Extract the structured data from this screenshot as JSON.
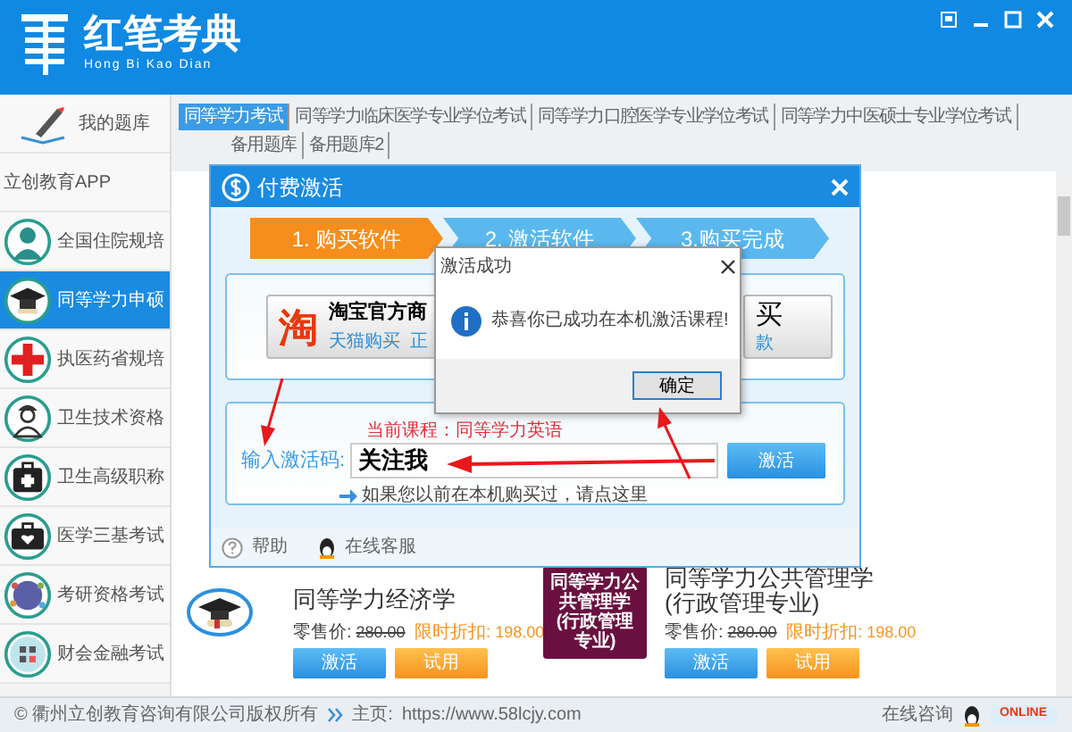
{
  "app": {
    "title": "红笔考典",
    "subtitle": "Hong Bi Kao Dian"
  },
  "sidebar": {
    "library": "我的题库",
    "app_link": "立创教育APP",
    "items": [
      {
        "label": "全国住院规培",
        "kind": "person",
        "selected": false
      },
      {
        "label": "同等学力申硕",
        "kind": "cap",
        "selected": true
      },
      {
        "label": "执医药省规培",
        "kind": "cross",
        "selected": false
      },
      {
        "label": "卫生技术资格",
        "kind": "nurse",
        "selected": false
      },
      {
        "label": "卫生高级职称",
        "kind": "kit",
        "selected": false
      },
      {
        "label": "医学三基考试",
        "kind": "bag",
        "selected": false
      },
      {
        "label": "考研资格考试",
        "kind": "group",
        "selected": false
      },
      {
        "label": "财会金融考试",
        "kind": "calc",
        "selected": false
      }
    ]
  },
  "tabs": [
    {
      "label": "同等学力考试",
      "selected": true
    },
    {
      "label": "同等学力临床医学专业学位考试",
      "selected": false
    },
    {
      "label": "同等学力口腔医学专业学位考试",
      "selected": false
    },
    {
      "label": "同等学力中医硕士专业学位考试",
      "selected": false
    },
    {
      "label": "备用题库",
      "selected": false
    },
    {
      "label": "备用题库2",
      "selected": false
    }
  ],
  "courses": [
    {
      "kind": "cap",
      "title": "同等学力经济学",
      "retail_label": "零售价:",
      "retail_price": "280.00",
      "discount_label": "限时折扣:",
      "discount_price": "198.00",
      "buttons": [
        "激活",
        "试用"
      ]
    },
    {
      "kind": "cover",
      "cover_text": "同等学力公共管理学(行政管理专业)",
      "title": "同等学力公共管理学(行政管理专业)",
      "retail_label": "零售价:",
      "retail_price": "280.00",
      "discount_label": "限时折扣:",
      "discount_price": "198.00",
      "buttons": [
        "激活",
        "试用"
      ]
    }
  ],
  "dialog": {
    "title": "付费激活",
    "steps": [
      {
        "label": "1. 购买软件",
        "selected": true
      },
      {
        "label": "2. 激活软件",
        "selected": false
      },
      {
        "label": "3.购买完成",
        "selected": false
      }
    ],
    "taobao": {
      "logo": "淘",
      "title": "淘宝官方商",
      "subtitle": "天猫购买  正"
    },
    "other_buy": {
      "title": "买",
      "subtitle": "款"
    },
    "current_course": "当前课程：同等学力英语",
    "code_label": "输入激活码:",
    "code_value": "关注我",
    "activate_button": "激活",
    "hint": "如果您以前在本机购买过，请点这里",
    "help": "帮助",
    "support": "在线客服"
  },
  "message_box": {
    "title": "激活成功",
    "message": "恭喜你已成功在本机激活课程!",
    "ok": "确定"
  },
  "status_bar": {
    "copyright": "© 衢州立创教育咨询有限公司版权所有",
    "homepage_label": "主页:",
    "homepage_url": "https://www.58lcjy.com",
    "online": "在线咨询",
    "badge": "ONLINE"
  }
}
